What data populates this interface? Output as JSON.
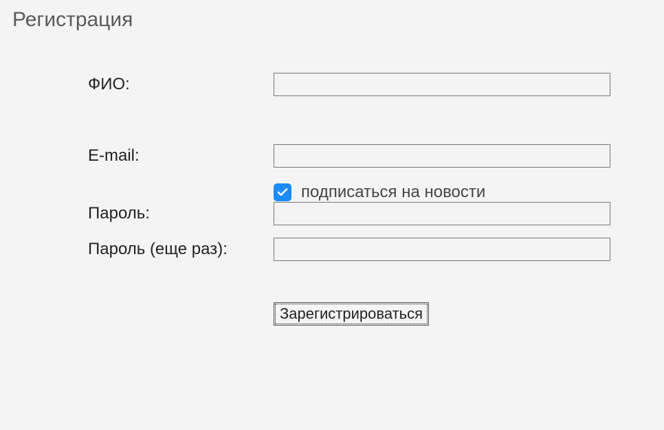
{
  "title": "Регистрация",
  "form": {
    "fio": {
      "label": "ФИО:",
      "value": ""
    },
    "email": {
      "label": "E-mail:",
      "value": ""
    },
    "subscribe": {
      "label": "подписаться на новости",
      "checked": true
    },
    "password": {
      "label": "Пароль:",
      "value": ""
    },
    "password_confirm": {
      "label": "Пароль (еще раз):",
      "value": ""
    },
    "submit_label": "Зарегистрироваться"
  }
}
